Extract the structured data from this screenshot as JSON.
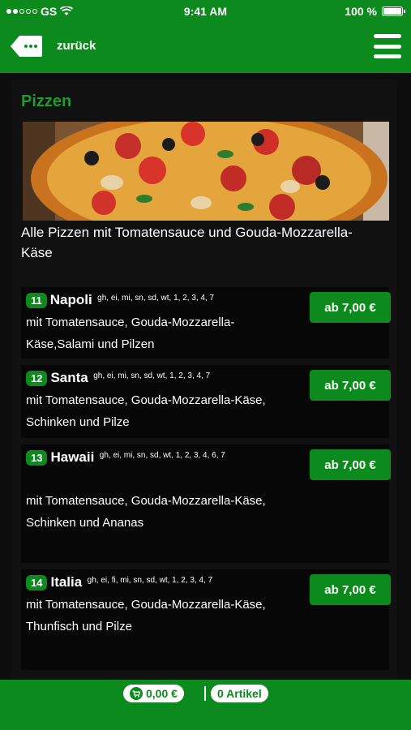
{
  "status": {
    "carrier": "GS",
    "time": "9:41 AM",
    "battery": "100 %"
  },
  "header": {
    "back_label": "zurück"
  },
  "section": {
    "title": "Pizzen",
    "intro": "Alle Pizzen mit Tomatensauce und Gouda-Mozzarella-Käse"
  },
  "items": [
    {
      "number": "11",
      "name": "Napoli",
      "allergens": "gh, ei, mi, sn, sd, wt, 1, 2, 3, 4, 7",
      "description": "mit Tomatensauce, Gouda-Mozzarella-Käse,Salami und Pilzen",
      "price": "ab 7,00 €"
    },
    {
      "number": "12",
      "name": "Santa",
      "allergens": "gh, ei, mi, sn, sd, wt, 1, 2, 3, 4, 7",
      "description": "mit Tomatensauce, Gouda-Mozzarella-Käse, Schinken und Pilze",
      "price": "ab 7,00 €"
    },
    {
      "number": "13",
      "name": "Hawaii",
      "allergens": "gh, ei, mi, sn, sd, wt, 1, 2, 3, 4, 6, 7",
      "description": "mit Tomatensauce, Gouda-Mozzarella-Käse, Schinken und Ananas",
      "price": "ab 7,00 €"
    },
    {
      "number": "14",
      "name": "Italia",
      "allergens": "gh, ei, fi, mi, sn, sd, wt, 1, 2, 3, 4, 7",
      "description": "mit Tomatensauce, Gouda-Mozzarella-Käse, Thunfisch und Pilze",
      "price": "ab 7,00 €"
    }
  ],
  "cart": {
    "total": "0,00 €",
    "count": "0 Artikel"
  },
  "colors": {
    "brand_green": "#0d8a1d",
    "title_green": "#1c9e2c",
    "background": "#0d0d0d"
  }
}
